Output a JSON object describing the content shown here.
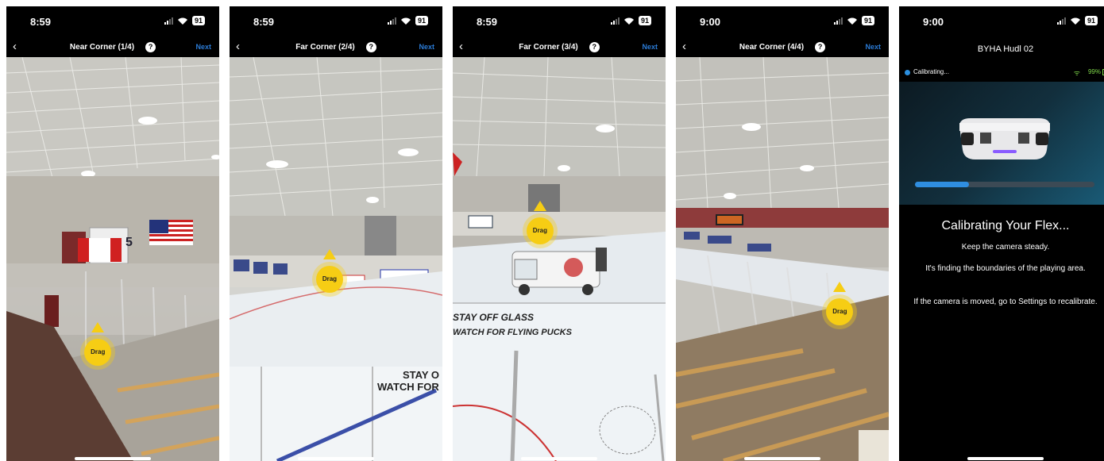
{
  "status_bar_common": {
    "battery": "91"
  },
  "screens": [
    {
      "time": "8:59",
      "title": "Near Corner (1/4)",
      "next_label": "Next",
      "drag_label": "Drag",
      "drag_pos": [
        0.43,
        0.73
      ]
    },
    {
      "time": "8:59",
      "title": "Far Corner (2/4)",
      "next_label": "Next",
      "drag_label": "Drag",
      "drag_pos": [
        0.47,
        0.55
      ]
    },
    {
      "time": "8:59",
      "title": "Far Corner (3/4)",
      "next_label": "Next",
      "drag_label": "Drag",
      "drag_pos": [
        0.41,
        0.43
      ]
    },
    {
      "time": "9:00",
      "title": "Near Corner (4/4)",
      "next_label": "Next",
      "drag_label": "Drag",
      "drag_pos": [
        0.77,
        0.63
      ]
    }
  ],
  "camera_text": {
    "banner_number": "5",
    "glass_text_1": "STAY OFF GLASS",
    "glass_text_2": "WATCH FOR FLYING PUCKS",
    "glass_text_short_1": "STAY O",
    "glass_text_short_2": "WATCH FOR"
  },
  "calibration": {
    "time": "9:00",
    "device_name": "BYHA Hudl 02",
    "status_text": "Calibrating...",
    "wifi_percent": "99%",
    "progress": 0.3,
    "heading": "Calibrating Your Flex...",
    "line1": "Keep the camera steady.",
    "line2": "It's finding the boundaries of the playing area.",
    "line3": "If the camera is moved, go to Settings to recalibrate."
  },
  "colors": {
    "accent_blue": "#2b7bd6",
    "drag_yellow": "#f6cd14",
    "battery_green": "#7fd84a"
  }
}
